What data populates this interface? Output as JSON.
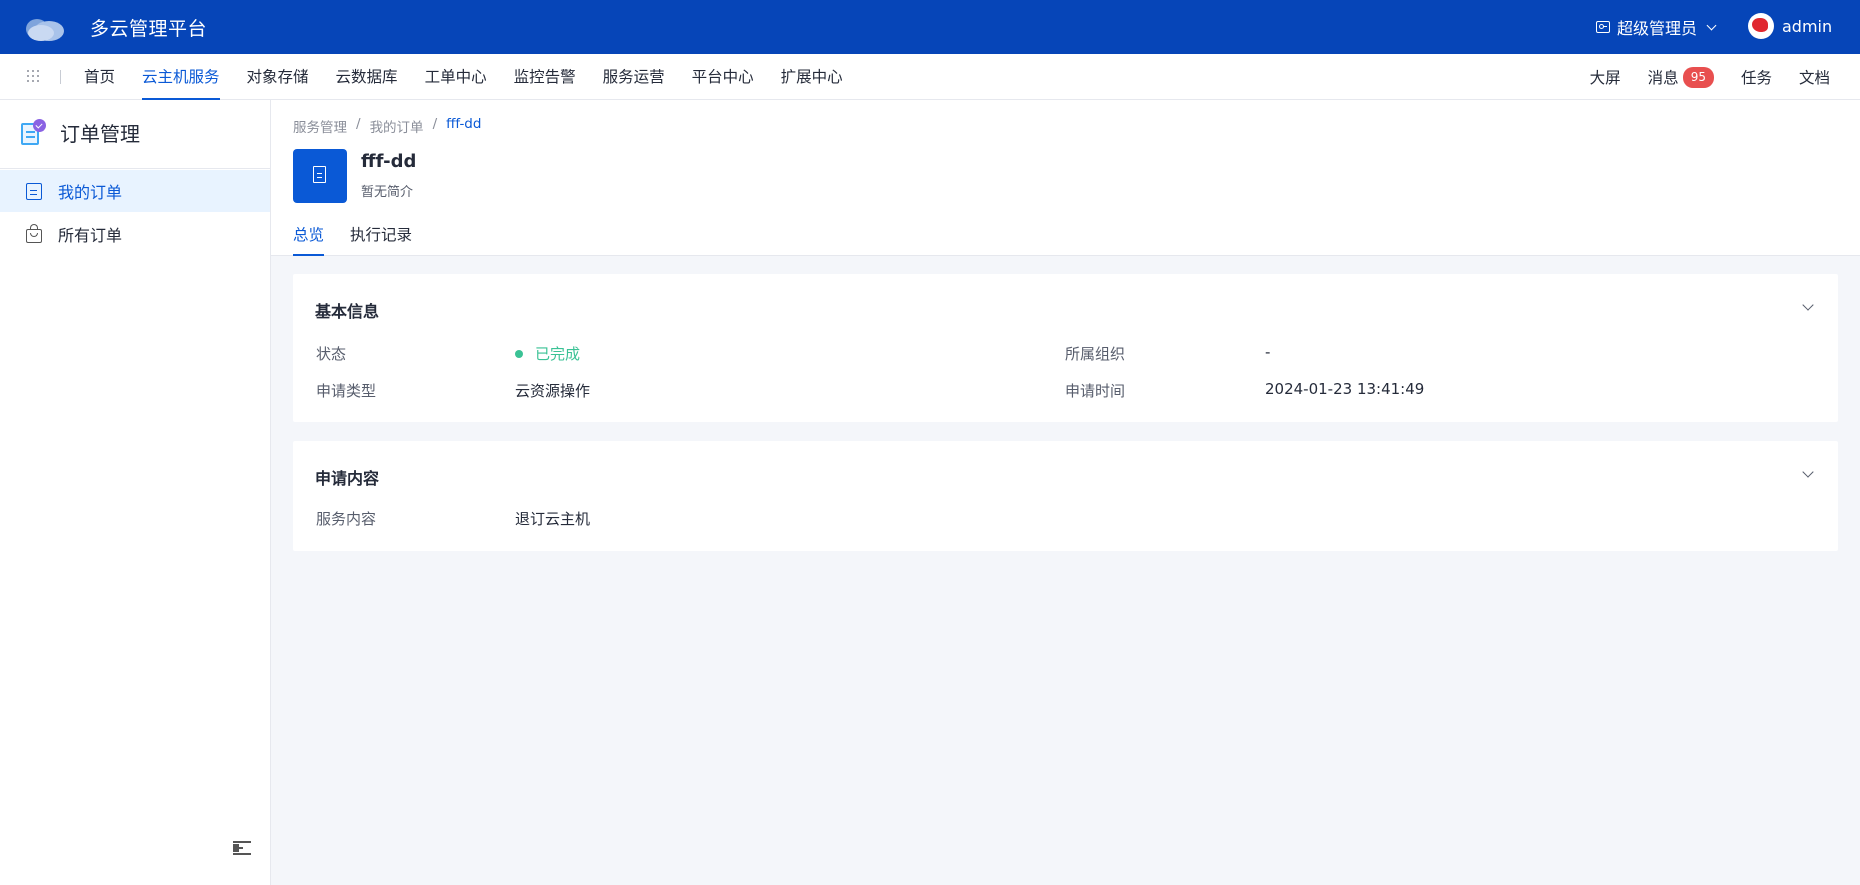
{
  "header": {
    "app_title": "多云管理平台",
    "role": "超级管理员",
    "user": "admin"
  },
  "nav": {
    "items": [
      "首页",
      "云主机服务",
      "对象存储",
      "云数据库",
      "工单中心",
      "监控告警",
      "服务运营",
      "平台中心",
      "扩展中心"
    ],
    "active_index": 1,
    "right": {
      "screen": "大屏",
      "messages": "消息",
      "message_count": "95",
      "tasks": "任务",
      "docs": "文档"
    }
  },
  "sidebar": {
    "title": "订单管理",
    "items": [
      {
        "label": "我的订单",
        "icon": "document-icon",
        "active": true
      },
      {
        "label": "所有订单",
        "icon": "bag-icon",
        "active": false
      }
    ]
  },
  "page": {
    "breadcrumb": [
      "服务管理",
      "我的订单",
      "fff-dd"
    ],
    "breadcrumb_sep": "/",
    "name": "fff-dd",
    "description": "暂无简介",
    "tabs": [
      "总览",
      "执行记录"
    ],
    "active_tab": 0
  },
  "basic_info": {
    "title": "基本信息",
    "status_label": "状态",
    "status_value": "已完成",
    "org_label": "所属组织",
    "org_value": "-",
    "type_label": "申请类型",
    "type_value": "云资源操作",
    "time_label": "申请时间",
    "time_value": "2024-01-23 13:41:49"
  },
  "request_content": {
    "title": "申请内容",
    "service_label": "服务内容",
    "service_value": "退订云主机"
  },
  "colors": {
    "header_bg": "#0645b8",
    "accent": "#0a59d6",
    "success": "#3ac295",
    "badge": "#e84f4f"
  }
}
